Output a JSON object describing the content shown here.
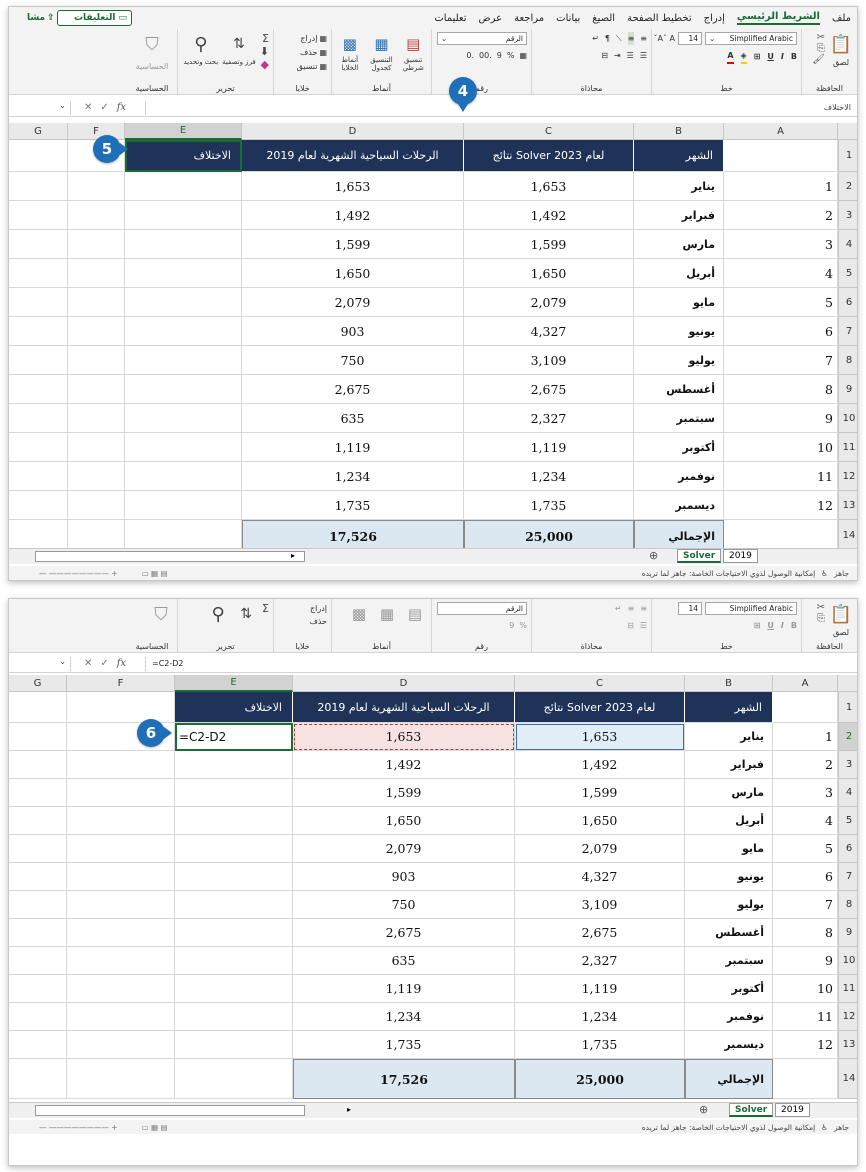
{
  "tabs": {
    "items": [
      "ملف",
      "الشريط الرئيسي",
      "إدراج",
      "تخطيط الصفحة",
      "الصيغ",
      "بيانات",
      "مراجعة",
      "عرض",
      "تعليمات"
    ],
    "comments": "التعليقات",
    "share": "مشا"
  },
  "ribbon": {
    "paste": "لصق",
    "clipboard": "الحافظة",
    "font_name": "Simplified Arabic",
    "font_size": "14",
    "font_group": "خط",
    "alignment": "محاذاة",
    "number_format": "الرقم",
    "number": "رقم",
    "conditional": "تنسيق شرطي",
    "format_table": "التنسيق كجدول",
    "cell_styles": "أنماط الخلايا",
    "styles": "أنماط",
    "insert": "إدراج",
    "delete": "حذف",
    "format": "تنسيق",
    "cells": "خلايا",
    "sort_filter": "فرز وتصفية",
    "find_select": "بحث وتحديد",
    "editing": "تحرير",
    "sensitivity": "الحساسية"
  },
  "formula_bar": {
    "name_box_p1": "الاختلاف",
    "formula_p2": "=C2-D2",
    "fx": "fx"
  },
  "columns": [
    "G",
    "F",
    "E",
    "D",
    "C",
    "B",
    "A"
  ],
  "rows": [
    "1",
    "2",
    "3",
    "4",
    "5",
    "6",
    "7",
    "8",
    "9",
    "10",
    "11",
    "12",
    "13",
    "14"
  ],
  "headers": {
    "month": "الشهر",
    "solver": "نتائج Solver لعام 2023",
    "trips": "الرحلات السياحية الشهرية لعام 2019",
    "diff": "الاختلاف"
  },
  "table": [
    {
      "i": "1",
      "m": "يناير",
      "c": "1,653",
      "d": "1,653"
    },
    {
      "i": "2",
      "m": "فبراير",
      "c": "1,492",
      "d": "1,492"
    },
    {
      "i": "3",
      "m": "مارس",
      "c": "1,599",
      "d": "1,599"
    },
    {
      "i": "4",
      "m": "أبريل",
      "c": "1,650",
      "d": "1,650"
    },
    {
      "i": "5",
      "m": "مايو",
      "c": "2,079",
      "d": "2,079"
    },
    {
      "i": "6",
      "m": "يونيو",
      "c": "4,327",
      "d": "903"
    },
    {
      "i": "7",
      "m": "يوليو",
      "c": "3,109",
      "d": "750"
    },
    {
      "i": "8",
      "m": "أغسطس",
      "c": "2,675",
      "d": "2,675"
    },
    {
      "i": "9",
      "m": "سبتمبر",
      "c": "2,327",
      "d": "635"
    },
    {
      "i": "10",
      "m": "أكتوبر",
      "c": "1,119",
      "d": "1,119"
    },
    {
      "i": "11",
      "m": "نوفمبر",
      "c": "1,234",
      "d": "1,234"
    },
    {
      "i": "12",
      "m": "ديسمبر",
      "c": "1,735",
      "d": "1,735"
    }
  ],
  "total": {
    "label": "الإجمالي",
    "c": "25,000",
    "d": "17,526"
  },
  "edit_cell": "=C2-D2",
  "sheets": [
    "Solver",
    "2019"
  ],
  "status": {
    "ready": "جاهز",
    "access": "إمكانية الوصول لذوي الاحتياجات الخاصة: جاهز لما تريده"
  },
  "badges": [
    "4",
    "5",
    "6"
  ],
  "accent": "#1a6b34",
  "header_color": "#1f3258",
  "badge_color": "#1e6fb8"
}
